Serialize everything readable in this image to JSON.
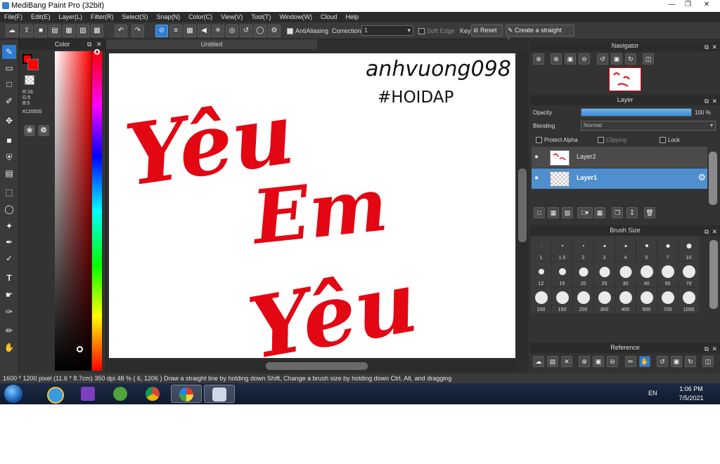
{
  "window": {
    "title": "MediBang Paint Pro (32bit)"
  },
  "menu": [
    "File(F)",
    "Edit(E)",
    "Layer(L)",
    "Filter(R)",
    "Select(S)",
    "Snap(N)",
    "Color(C)",
    "View(V)",
    "Tool(T)",
    "Window(W)",
    "Cloud",
    "Help"
  ],
  "toolbar": {
    "antialiasing": "AntiAliasing",
    "correction_label": "Correction",
    "correction_value": "1",
    "soft_edge": "Soft Edge",
    "key_label": "Key",
    "reset": "Reset",
    "straight_line": "Create a straight line"
  },
  "document": {
    "tab": "Untitled"
  },
  "color_panel": {
    "title": "Color",
    "rgb": {
      "r": "R:18",
      "g": "G:5",
      "b": "B:5"
    },
    "hex": "#120505",
    "main_color": "#ff0000"
  },
  "navigator": {
    "title": "Navigator"
  },
  "layer_panel": {
    "title": "Layer",
    "opacity_label": "Opacity",
    "opacity_value": "100 %",
    "opacity": 100,
    "blending_label": "Blending",
    "blending_value": "Normal",
    "protect_alpha": "Protect Alpha",
    "clipping": "Clipping",
    "lock": "Lock",
    "layers": [
      {
        "name": "Layer2",
        "selected": false
      },
      {
        "name": "Layer1",
        "selected": true
      }
    ]
  },
  "brush_panel": {
    "title": "Brush Size",
    "sizes": [
      "1",
      "1.5",
      "2",
      "3",
      "4",
      "5",
      "7",
      "10",
      "12",
      "15",
      "20",
      "25",
      "30",
      "40",
      "50",
      "70",
      "100",
      "150",
      "200",
      "300",
      "400",
      "500",
      "700",
      "1000"
    ]
  },
  "reference_panel": {
    "title": "Reference"
  },
  "status": "1600 * 1200 pixel   (11.6 * 8.7cm)   350 dpi   48 %   ( 6, 1206 )   Draw a straight line by holding down Shift, Change a brush size by holding down Ctrl, Alt, and dragging",
  "taskbar": {
    "lang": "EN",
    "time": "1:06 PM",
    "date": "7/5/2021"
  },
  "artwork": {
    "signature_lines": [
      "anhvuong098",
      "#HOIDAP"
    ],
    "words": [
      "Yêu",
      "Em",
      "Yêu"
    ],
    "ink_color": "#e30613"
  }
}
